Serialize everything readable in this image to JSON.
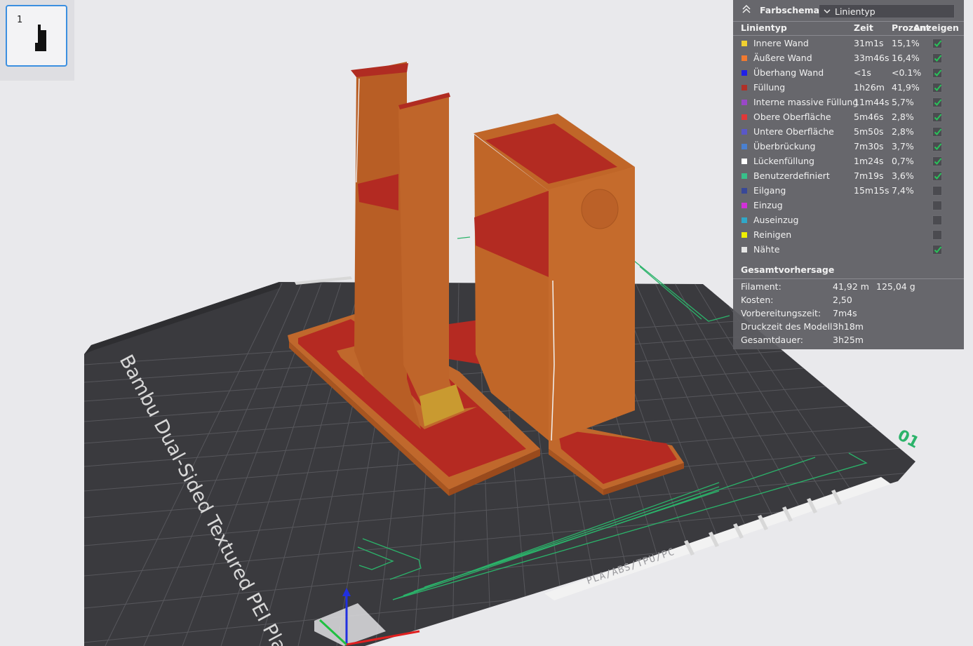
{
  "plate": {
    "number": "1"
  },
  "legend": {
    "title": "Farbschema",
    "selected_scheme": "Linientyp",
    "headers": {
      "type": "Linientyp",
      "time": "Zeit",
      "percent": "Prozent",
      "show": "Anzeigen"
    },
    "rows": [
      {
        "name": "Innere Wand",
        "time": "31m1s",
        "percent": "15,1%",
        "color": "#f0d030",
        "checked": true
      },
      {
        "name": "Äußere Wand",
        "time": "33m46s",
        "percent": "16,4%",
        "color": "#f07a30",
        "checked": true
      },
      {
        "name": "Überhang Wand",
        "time": "<1s",
        "percent": "<0.1%",
        "color": "#2020e8",
        "checked": true
      },
      {
        "name": "Füllung",
        "time": "1h26m",
        "percent": "41,9%",
        "color": "#b03028",
        "checked": true
      },
      {
        "name": "Interne massive Füllung",
        "time": "11m44s",
        "percent": "5,7%",
        "color": "#9a48c8",
        "checked": true
      },
      {
        "name": "Obere Oberfläche",
        "time": "5m46s",
        "percent": "2,8%",
        "color": "#e03838",
        "checked": true
      },
      {
        "name": "Untere Oberfläche",
        "time": "5m50s",
        "percent": "2,8%",
        "color": "#5a58c8",
        "checked": true
      },
      {
        "name": "Überbrückung",
        "time": "7m30s",
        "percent": "3,7%",
        "color": "#4a80d0",
        "checked": true
      },
      {
        "name": "Lückenfüllung",
        "time": "1m24s",
        "percent": "0,7%",
        "color": "#ffffff",
        "checked": true
      },
      {
        "name": "Benutzerdefiniert",
        "time": "7m19s",
        "percent": "3,6%",
        "color": "#38c08a",
        "checked": true
      },
      {
        "name": "Eilgang",
        "time": "15m15s",
        "percent": "7,4%",
        "color": "#384898",
        "checked": false
      },
      {
        "name": "Einzug",
        "time": "",
        "percent": "",
        "color": "#d030d8",
        "checked": false
      },
      {
        "name": "Auseinzug",
        "time": "",
        "percent": "",
        "color": "#30a8c8",
        "checked": false
      },
      {
        "name": "Reinigen",
        "time": "",
        "percent": "",
        "color": "#f0f000",
        "checked": false
      },
      {
        "name": "Nähte",
        "time": "",
        "percent": "",
        "color": "#e6e6e6",
        "checked": true
      }
    ],
    "summary_title": "Gesamtvorhersage",
    "summary": [
      {
        "label": "Filament:",
        "value": "41,92 m",
        "value2": "125,04 g"
      },
      {
        "label": "Kosten:",
        "value": "2,50",
        "value2": ""
      },
      {
        "label": "Vorbereitungszeit:",
        "value": "7m4s",
        "value2": ""
      },
      {
        "label": "Druckzeit des Modell:",
        "value": "3h18m",
        "value2": ""
      },
      {
        "label": "Gesamtdauer:",
        "value": "3h25m",
        "value2": ""
      }
    ]
  },
  "bed": {
    "plate_name": "Bambu Dual-Sided Textured PEI Plate",
    "material_label": "PLA/ABS/TPU/PC",
    "plate_index": "01"
  },
  "colors": {
    "bed_dark": "#3a3a3e",
    "grid_line": "#57575c",
    "model_orange": "#c06628",
    "model_red": "#b02a22",
    "accent_blue": "#3b8fe0",
    "check_green": "#29c25a"
  }
}
